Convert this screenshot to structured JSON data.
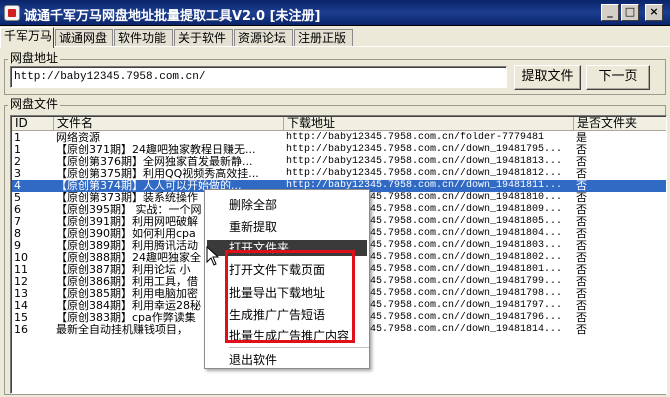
{
  "window": {
    "title": "诚通千军万马网盘地址批量提取工具V2.0 [未注册]"
  },
  "tabs": [
    "千军万马",
    "诚通网盘",
    "软件功能",
    "关于软件",
    "资源论坛",
    "注册正版"
  ],
  "address_group": {
    "label": "网盘地址",
    "input_value": "http://baby12345.7958.com.cn/",
    "extract_button": "提取文件",
    "next_button": "下一页"
  },
  "files_group": {
    "label": "网盘文件",
    "columns": [
      "ID",
      "文件名",
      "下载地址",
      "是否文件夹"
    ],
    "rows": [
      {
        "id": "1",
        "name": "网络资源",
        "url": "http://baby12345.7958.com.cn/folder-7779481",
        "folder": "是"
      },
      {
        "id": "1",
        "name": "【原创371期】24趣吧独家教程日赚无...",
        "url": "http://baby12345.7958.com.cn//down_19481795...",
        "folder": "否"
      },
      {
        "id": "2",
        "name": "【原创第376期】全网独家首发最新静...",
        "url": "http://baby12345.7958.com.cn//down_19481813...",
        "folder": "否"
      },
      {
        "id": "3",
        "name": "【原创第375期】利用QQ视频秀高效挂...",
        "url": "http://baby12345.7958.com.cn//down_19481812...",
        "folder": "否"
      },
      {
        "id": "4",
        "name": "【原创第374期】人人可以开始做的...",
        "url": "http://baby12345.7958.com.cn//down_19481811...",
        "folder": "否"
      },
      {
        "id": "5",
        "name": "【原创第373期】装系统操作",
        "url": "http://baby12345.7958.com.cn//down_19481810...",
        "folder": "否"
      },
      {
        "id": "6",
        "name": "【原创395期】 实战：一个网",
        "url": "http://baby12345.7958.com.cn//down_19481809...",
        "folder": "否"
      },
      {
        "id": "7",
        "name": "【原创391期】利用网吧破解",
        "url": "http://baby12345.7958.com.cn//down_19481805...",
        "folder": "否"
      },
      {
        "id": "8",
        "name": "【原创390期】如何利用cpa",
        "url": "http://baby12345.7958.com.cn//down_19481804...",
        "folder": "否"
      },
      {
        "id": "9",
        "name": "【原创389期】利用腾讯活动",
        "url": "http://baby12345.7958.com.cn//down_19481803...",
        "folder": "否"
      },
      {
        "id": "10",
        "name": "【原创388期】24趣吧独家全",
        "url": "http://baby12345.7958.com.cn//down_19481802...",
        "folder": "否"
      },
      {
        "id": "11",
        "name": "【原创387期】利用论坛 小",
        "url": "http://baby12345.7958.com.cn//down_19481801...",
        "folder": "否"
      },
      {
        "id": "12",
        "name": "【原创386期】利用工具，借",
        "url": "http://baby12345.7958.com.cn//down_19481799...",
        "folder": "否"
      },
      {
        "id": "13",
        "name": "【原创385期】利用电脑加密",
        "url": "http://baby12345.7958.com.cn//down_19481798...",
        "folder": "否"
      },
      {
        "id": "14",
        "name": "【原创384期】利用幸运28秘",
        "url": "http://baby12345.7958.com.cn//down_19481797...",
        "folder": "否"
      },
      {
        "id": "15",
        "name": "【原创383期】cpa作弊读集",
        "url": "http://baby12345.7958.com.cn//down_19481796...",
        "folder": "否"
      },
      {
        "id": "16",
        "name": "最新全自动挂机赚钱项目，",
        "url": "http://baby12345.7958.com.cn//down_19481814...",
        "folder": "否"
      }
    ]
  },
  "context_menu": {
    "items": [
      "删除全部",
      "重新提取",
      "打开文件夹",
      "打开文件下载页面",
      "批量导出下载地址",
      "生成推广广告短语",
      "批量生成广告推广内容",
      "退出软件"
    ],
    "highlighted": "打开文件夹"
  },
  "colors": {
    "title_bar": "#0a246a",
    "selection": "#316ac5",
    "highlight_box": "#e0101a"
  }
}
